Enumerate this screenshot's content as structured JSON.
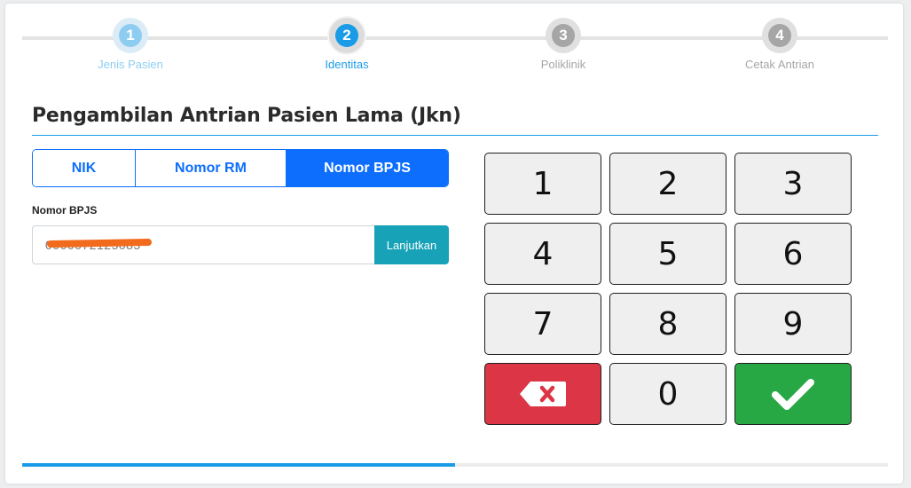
{
  "stepper": {
    "steps": [
      {
        "number": "1",
        "label": "Jenis Pasien",
        "state": "done"
      },
      {
        "number": "2",
        "label": "Identitas",
        "state": "active"
      },
      {
        "number": "3",
        "label": "Poliklinik",
        "state": "todo"
      },
      {
        "number": "4",
        "label": "Cetak Antrian",
        "state": "todo"
      }
    ]
  },
  "page": {
    "title": "Pengambilan Antrian Pasien Lama (Jkn)"
  },
  "tabs": [
    {
      "label": "NIK",
      "active": false
    },
    {
      "label": "Nomor RM",
      "active": false
    },
    {
      "label": "Nomor BPJS",
      "active": true
    }
  ],
  "form": {
    "field_label": "Nomor BPJS",
    "input_value": "0000072125085",
    "submit_label": "Lanjutkan"
  },
  "keypad": {
    "keys": [
      "1",
      "2",
      "3",
      "4",
      "5",
      "6",
      "7",
      "8",
      "9"
    ],
    "zero": "0",
    "delete_icon": "backspace-x-icon",
    "confirm_icon": "checkmark-icon"
  },
  "progress": {
    "fraction": 0.5
  },
  "colors": {
    "accent": "#1a9be8",
    "tab_primary": "#0d6efd",
    "submit": "#17a2b8",
    "delete": "#dc3545",
    "confirm": "#28a745",
    "redaction": "#f26a1b"
  }
}
